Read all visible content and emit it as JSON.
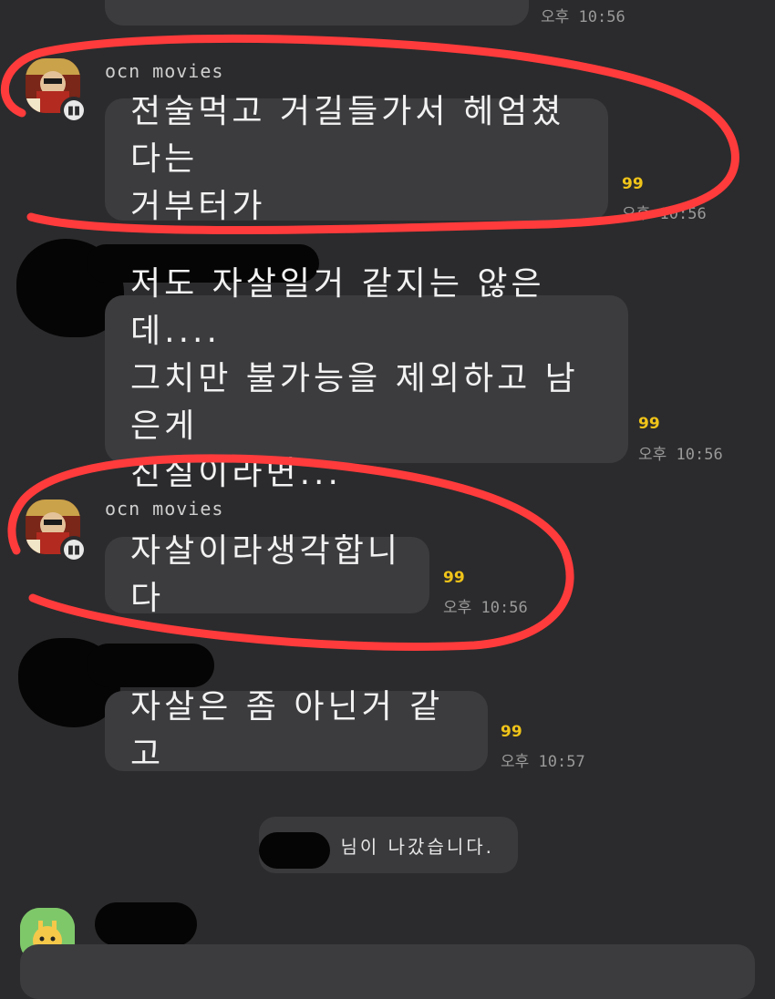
{
  "colors": {
    "background": "#2b2b2d",
    "bubble": "#3c3c3f",
    "unread_count": "#f0c419",
    "annotation": "#ff3b3b",
    "redaction": "#050505"
  },
  "messages": [
    {
      "time": "오후 10:56"
    },
    {
      "sender": "ocn movies",
      "text": "전술먹고 거길들가서 헤엄쳤다는\n거부터가",
      "unread": "99",
      "time": "오후 10:56"
    },
    {
      "text": "저도 자살일거 같지는 않은데....\n그치만 불가능을 제외하고 남은게\n진실이라면...",
      "unread": "99",
      "time": "오후 10:56"
    },
    {
      "sender": "ocn movies",
      "text": "자살이라생각합니다",
      "unread": "99",
      "time": "오후 10:56"
    },
    {
      "text": "자살은 좀 아닌거 같고",
      "unread": "99",
      "time": "오후 10:57"
    }
  ],
  "system_notice": {
    "text": "님이 나갔습니다."
  },
  "avatars": {
    "ocn": "profile-photo",
    "last": "character-avatar"
  }
}
